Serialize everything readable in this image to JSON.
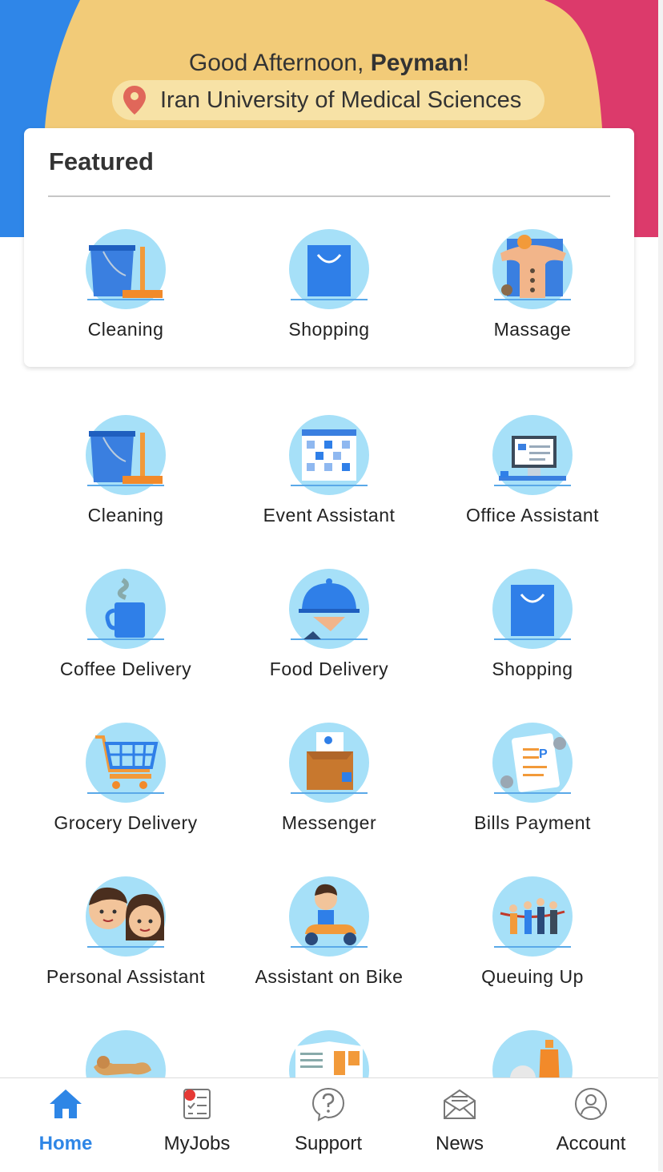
{
  "header": {
    "greeting_prefix": "Good Afternoon, ",
    "user_name": "Peyman",
    "greeting_suffix": "!",
    "location": "Iran University of Medical Sciences"
  },
  "featured": {
    "title": "Featured",
    "items": [
      {
        "label": "Cleaning",
        "icon": "cleaning-icon"
      },
      {
        "label": "Shopping",
        "icon": "shopping-bag-icon"
      },
      {
        "label": "Massage",
        "icon": "massage-icon"
      }
    ]
  },
  "services": [
    {
      "label": "Cleaning",
      "icon": "cleaning-icon"
    },
    {
      "label": "Event Assistant",
      "icon": "calendar-icon"
    },
    {
      "label": "Office Assistant",
      "icon": "computer-icon"
    },
    {
      "label": "Coffee Delivery",
      "icon": "coffee-mug-icon"
    },
    {
      "label": "Food Delivery",
      "icon": "cloche-icon"
    },
    {
      "label": "Shopping",
      "icon": "shopping-bag-icon"
    },
    {
      "label": "Grocery Delivery",
      "icon": "shopping-cart-icon"
    },
    {
      "label": "Messenger",
      "icon": "package-icon"
    },
    {
      "label": "Bills Payment",
      "icon": "bill-icon"
    },
    {
      "label": "Personal Assistant",
      "icon": "people-icon"
    },
    {
      "label": "Assistant on Bike",
      "icon": "scooter-icon"
    },
    {
      "label": "Queuing Up",
      "icon": "queue-icon"
    },
    {
      "label": "",
      "icon": "dog-icon"
    },
    {
      "label": "",
      "icon": "newspaper-icon"
    },
    {
      "label": "",
      "icon": "bottle-icon"
    }
  ],
  "nav": [
    {
      "label": "Home",
      "icon": "home-icon",
      "active": true
    },
    {
      "label": "MyJobs",
      "icon": "checklist-icon",
      "badge": true
    },
    {
      "label": "Support",
      "icon": "help-icon"
    },
    {
      "label": "News",
      "icon": "mail-icon"
    },
    {
      "label": "Account",
      "icon": "user-icon"
    }
  ],
  "colors": {
    "header_blue": "#2f86e8",
    "header_yellow": "#f2cb78",
    "header_pink": "#dc3a6b",
    "accent": "#2e86e6",
    "icon_circle": "#a6e0f8",
    "badge": "#e53935"
  }
}
